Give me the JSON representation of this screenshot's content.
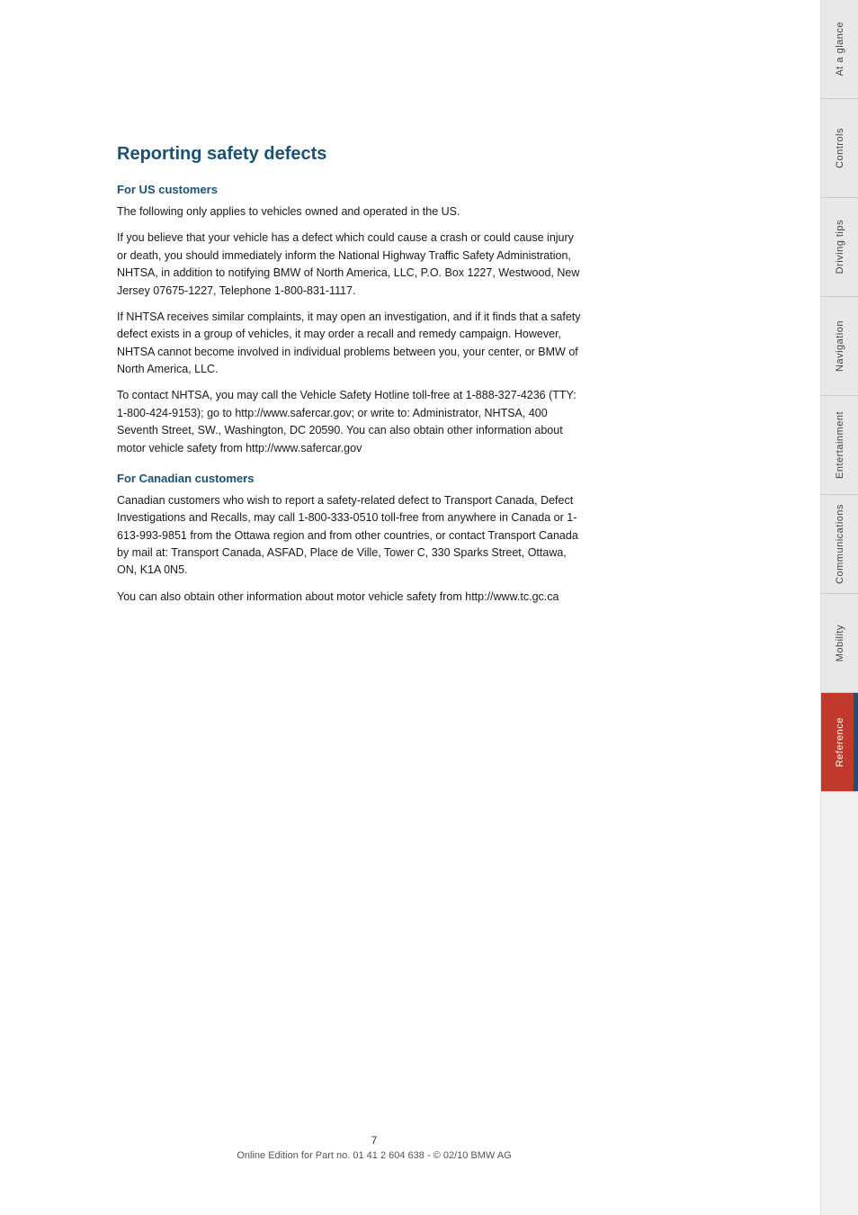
{
  "page": {
    "title": "Reporting safety defects",
    "page_number": "7",
    "footer_text": "Online Edition for Part no. 01 41 2 604 638 - © 02/10 BMW AG"
  },
  "sections": {
    "us_heading": "For US customers",
    "us_para1": "The following only applies to vehicles owned and operated in the US.",
    "us_para2": "If you believe that your vehicle has a defect which could cause a crash or could cause injury or death, you should immediately inform the National Highway Traffic Safety Administration, NHTSA, in addition to notifying BMW of North America, LLC, P.O. Box 1227, Westwood, New Jersey 07675-1227, Telephone 1-800-831-1117.",
    "us_para3": "If NHTSA receives similar complaints, it may open an investigation, and if it finds that a safety defect exists in a group of vehicles, it may order a recall and remedy campaign. However, NHTSA cannot become involved in individual problems between you, your center, or BMW of North America, LLC.",
    "us_para4": "To contact NHTSA, you may call the Vehicle Safety Hotline toll-free at 1-888-327-4236 (TTY: 1-800-424-9153); go to http://www.safercar.gov; or write to: Administrator, NHTSA, 400 Seventh Street, SW., Washington, DC 20590. You can also obtain other information about motor vehicle safety from http://www.safercar.gov",
    "canada_heading": "For Canadian customers",
    "canada_para1": "Canadian customers who wish to report a safety-related defect to Transport Canada, Defect Investigations and Recalls, may call 1-800-333-0510 toll-free from anywhere in Canada or 1-613-993-9851 from the Ottawa region and from other countries, or contact Transport Canada by mail at: Transport Canada, ASFAD, Place de Ville, Tower C, 330 Sparks Street, Ottawa, ON, K1A 0N5.",
    "canada_para2": "You can also obtain other information about motor vehicle safety from http://www.tc.gc.ca"
  },
  "sidebar": {
    "tabs": [
      {
        "label": "At a glance",
        "active": false
      },
      {
        "label": "Controls",
        "active": false
      },
      {
        "label": "Driving tips",
        "active": false
      },
      {
        "label": "Navigation",
        "active": false
      },
      {
        "label": "Entertainment",
        "active": false
      },
      {
        "label": "Communications",
        "active": false
      },
      {
        "label": "Mobility",
        "active": false
      },
      {
        "label": "Reference",
        "active": true
      }
    ]
  }
}
